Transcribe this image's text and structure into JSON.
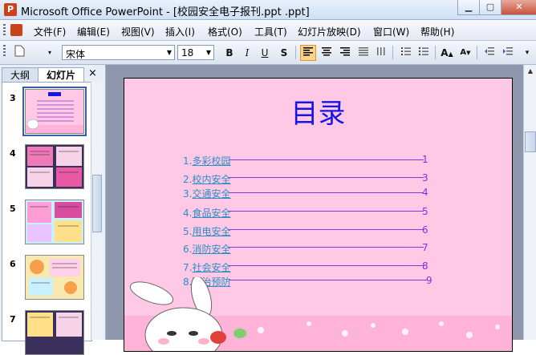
{
  "window": {
    "title": "Microsoft Office PowerPoint - [校园安全电子报刊.ppt .ppt]",
    "app_icon": "P"
  },
  "menu": [
    "文件(F)",
    "编辑(E)",
    "视图(V)",
    "插入(I)",
    "格式(O)",
    "工具(T)",
    "幻灯片放映(D)",
    "窗口(W)",
    "帮助(H)"
  ],
  "toolbar": {
    "font": "宋体",
    "size": "18",
    "bold": "B",
    "italic": "I",
    "underline": "U",
    "shadow": "S",
    "grow": "A",
    "shrink": "A"
  },
  "panel": {
    "tabs": [
      "大纲",
      "幻灯片"
    ],
    "close": "×",
    "slide_numbers": [
      "3",
      "4",
      "5",
      "6",
      "7"
    ]
  },
  "slide": {
    "title": "目录",
    "toc": [
      {
        "label": "1.",
        "text": "多彩校园",
        "page": "1"
      },
      {
        "label": "2.",
        "text": "校内安全",
        "page": "3"
      },
      {
        "label": "3.",
        "text": "交通安全",
        "page": "4"
      },
      {
        "label": "4.",
        "text": "食品安全",
        "page": "5"
      },
      {
        "label": "5.",
        "text": "用电安全",
        "page": "6"
      },
      {
        "label": "6.",
        "text": "消防安全",
        "page": "7"
      },
      {
        "label": "7.",
        "text": "社会安全",
        "page": "8"
      },
      {
        "label": "8.",
        "text": "防治预防",
        "page": "9"
      }
    ]
  },
  "colors": {
    "slide_bg": "#ffc8e4",
    "title": "#1515e6",
    "toc_text": "#2b8fc6",
    "toc_line": "#8a36d6"
  }
}
